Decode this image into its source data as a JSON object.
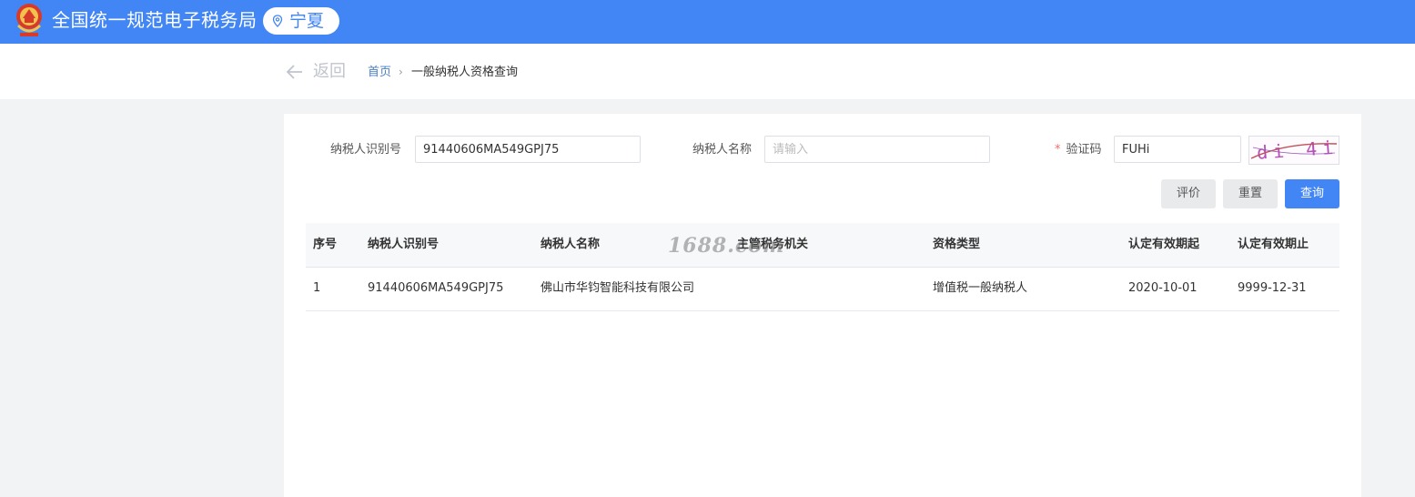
{
  "header": {
    "site_title": "全国统一规范电子税务局",
    "region": "宁夏"
  },
  "breadcrumb": {
    "back_label": "返回",
    "home": "首页",
    "separator": "›",
    "current": "一般纳税人资格查询"
  },
  "form": {
    "taxpayer_id_label": "纳税人识别号",
    "taxpayer_id_value": "91440606MA549GPJ75",
    "taxpayer_name_label": "纳税人名称",
    "taxpayer_name_placeholder": "请输入",
    "taxpayer_name_value": "",
    "captcha_required_mark": "*",
    "captcha_label": "验证码",
    "captcha_value": "FUHi",
    "captcha_image_text": "di 4i"
  },
  "buttons": {
    "evaluate": "评价",
    "reset": "重置",
    "query": "查询"
  },
  "table": {
    "columns": [
      "序号",
      "纳税人识别号",
      "纳税人名称",
      "主管税务机关",
      "资格类型",
      "认定有效期起",
      "认定有效期止"
    ],
    "rows": [
      [
        "1",
        "91440606MA549GPJ75",
        "佛山市华钧智能科技有限公司",
        "",
        "增值税一般纳税人",
        "2020-10-01",
        "9999-12-31"
      ]
    ]
  },
  "watermark": "1688.com",
  "colors": {
    "brand_blue": "#4285f4",
    "required_red": "#f56c6c",
    "page_bg": "#f2f3f5"
  }
}
